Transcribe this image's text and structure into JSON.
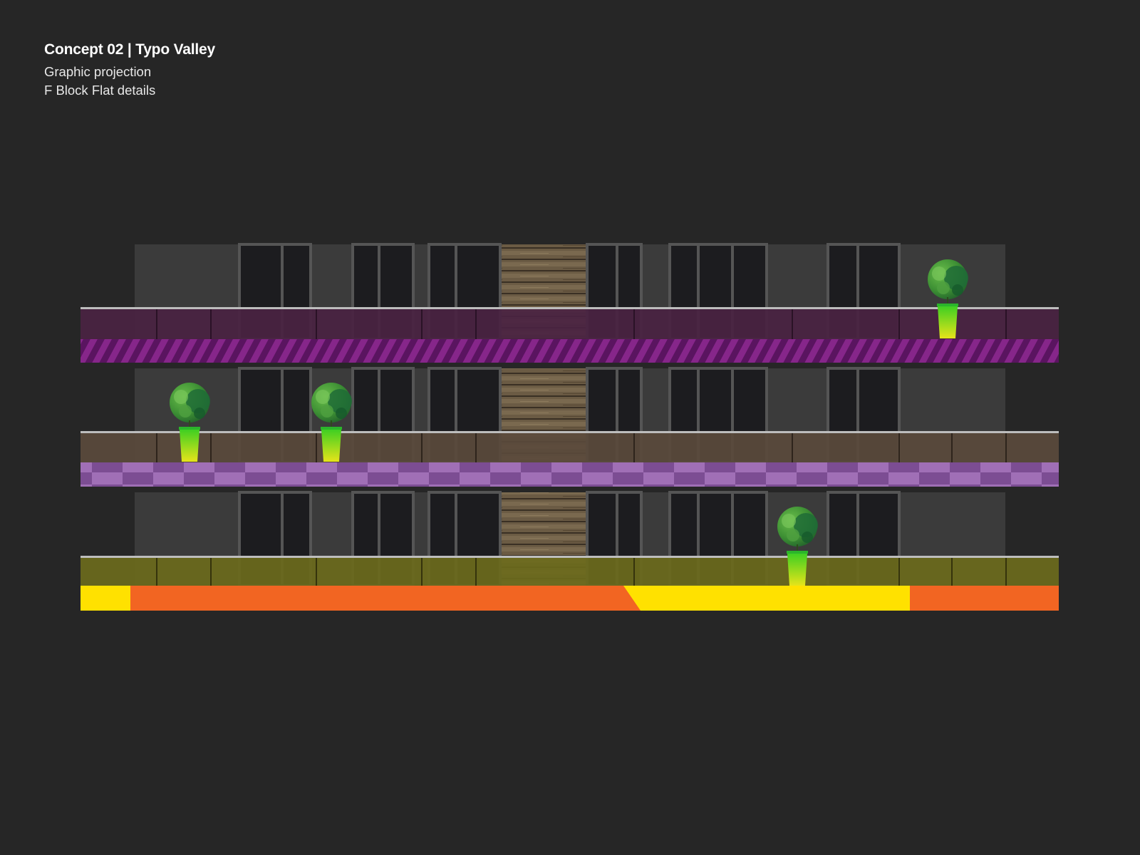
{
  "header": {
    "title": "Concept 02 | Typo Valley",
    "subtitle": "Graphic projection",
    "caption": "F Block Flat details"
  },
  "colors": {
    "background": "#262626",
    "facade": "#3b3b3b",
    "window_frame": "#555555",
    "window_glass": "#1c1c1f",
    "timber": "#6e5d45",
    "rail": "#bdbdbd"
  },
  "floors": [
    {
      "name": "top-floor",
      "glass_color": "#4a2342",
      "band_pattern": "diagonal-stripes",
      "band_colors": [
        "#7b1a7e",
        "#5a1460"
      ]
    },
    {
      "name": "middle-floor",
      "glass_color": "#5a4a3c",
      "band_pattern": "checkerboard",
      "band_colors": [
        "#a06fb6",
        "#7c4d93"
      ]
    },
    {
      "name": "bottom-floor",
      "glass_color": "#6b6a1c",
      "band_pattern": "color-blocks",
      "band_colors": [
        "#ffe100",
        "#f26522"
      ]
    }
  ],
  "plants": [
    {
      "floor": 0,
      "icon": "potted-tree-icon"
    },
    {
      "floor": 1,
      "icon": "potted-tree-icon"
    },
    {
      "floor": 1,
      "icon": "potted-tree-icon"
    },
    {
      "floor": 2,
      "icon": "potted-tree-icon"
    }
  ]
}
